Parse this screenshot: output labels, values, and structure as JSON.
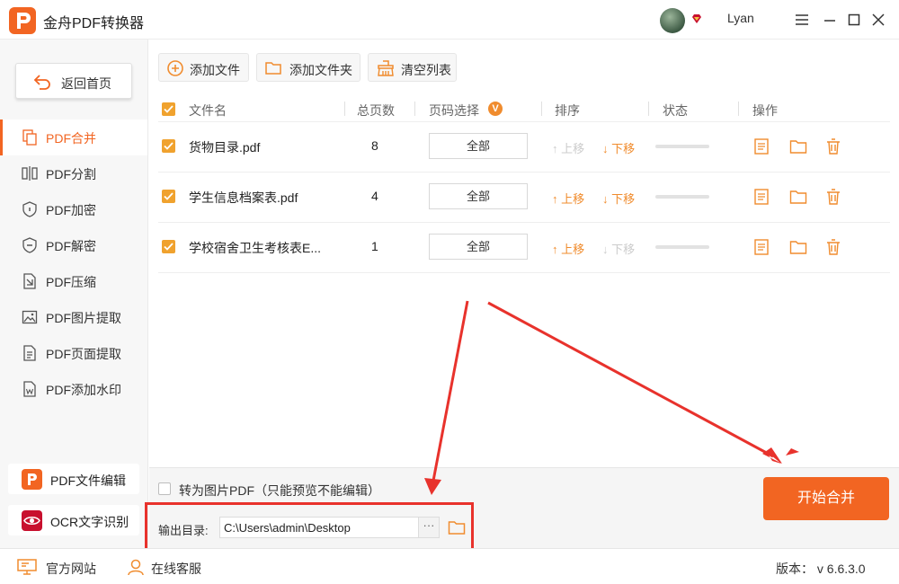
{
  "app": {
    "title": "金舟PDF转换器",
    "username": "Lyan",
    "logo_letter": "P"
  },
  "window_controls": [
    "menu-icon",
    "minimize-icon",
    "maximize-icon",
    "close-icon"
  ],
  "sidebar": {
    "home_label": "返回首页",
    "items": [
      {
        "label": "PDF合并",
        "icon": "merge-icon",
        "active": true
      },
      {
        "label": "PDF分割",
        "icon": "split-icon",
        "active": false
      },
      {
        "label": "PDF加密",
        "icon": "shield-lock-icon",
        "active": false
      },
      {
        "label": "PDF解密",
        "icon": "shield-unlock-icon",
        "active": false
      },
      {
        "label": "PDF压缩",
        "icon": "compress-icon",
        "active": false
      },
      {
        "label": "PDF图片提取",
        "icon": "image-icon",
        "active": false
      },
      {
        "label": "PDF页面提取",
        "icon": "page-icon",
        "active": false
      },
      {
        "label": "PDF添加水印",
        "icon": "watermark-icon",
        "active": false
      }
    ],
    "cards": [
      {
        "label": "PDF文件编辑",
        "icon": "pdf-edit-icon",
        "color": "#f26522"
      },
      {
        "label": "OCR文字识别",
        "icon": "ocr-eye-icon",
        "color": "#c8102e"
      }
    ]
  },
  "toolbar": {
    "add_file": "添加文件",
    "add_folder": "添加文件夹",
    "clear_list": "清空列表"
  },
  "table": {
    "headers": {
      "filename": "文件名",
      "pages": "总页数",
      "page_select": "页码选择",
      "page_select_badge": "V",
      "sort": "排序",
      "status": "状态",
      "actions": "操作"
    },
    "rows": [
      {
        "checked": true,
        "filename": "货物目录.pdf",
        "pages": "8",
        "page_select": "全部",
        "up": "上移",
        "down": "下移",
        "up_enabled": false,
        "down_enabled": true
      },
      {
        "checked": true,
        "filename": "学生信息档案表.pdf",
        "pages": "4",
        "page_select": "全部",
        "up": "上移",
        "down": "下移",
        "up_enabled": true,
        "down_enabled": true
      },
      {
        "checked": true,
        "filename": "学校宿舍卫生考核表E...",
        "pages": "1",
        "page_select": "全部",
        "up": "上移",
        "down": "下移",
        "up_enabled": true,
        "down_enabled": false
      }
    ]
  },
  "options": {
    "to_image_label": "转为图片PDF（只能预览不能编辑）",
    "to_image_checked": false
  },
  "output": {
    "label": "输出目录:",
    "path": "C:\\Users\\admin\\Desktop",
    "more": "···"
  },
  "start_button": "开始合并",
  "footer": {
    "website": "官方网站",
    "support": "在线客服",
    "version": "版本： v 6.6.3.0"
  },
  "colors": {
    "accent": "#f26522",
    "checkbox": "#f0a22e",
    "annotation": "#e8322c"
  }
}
